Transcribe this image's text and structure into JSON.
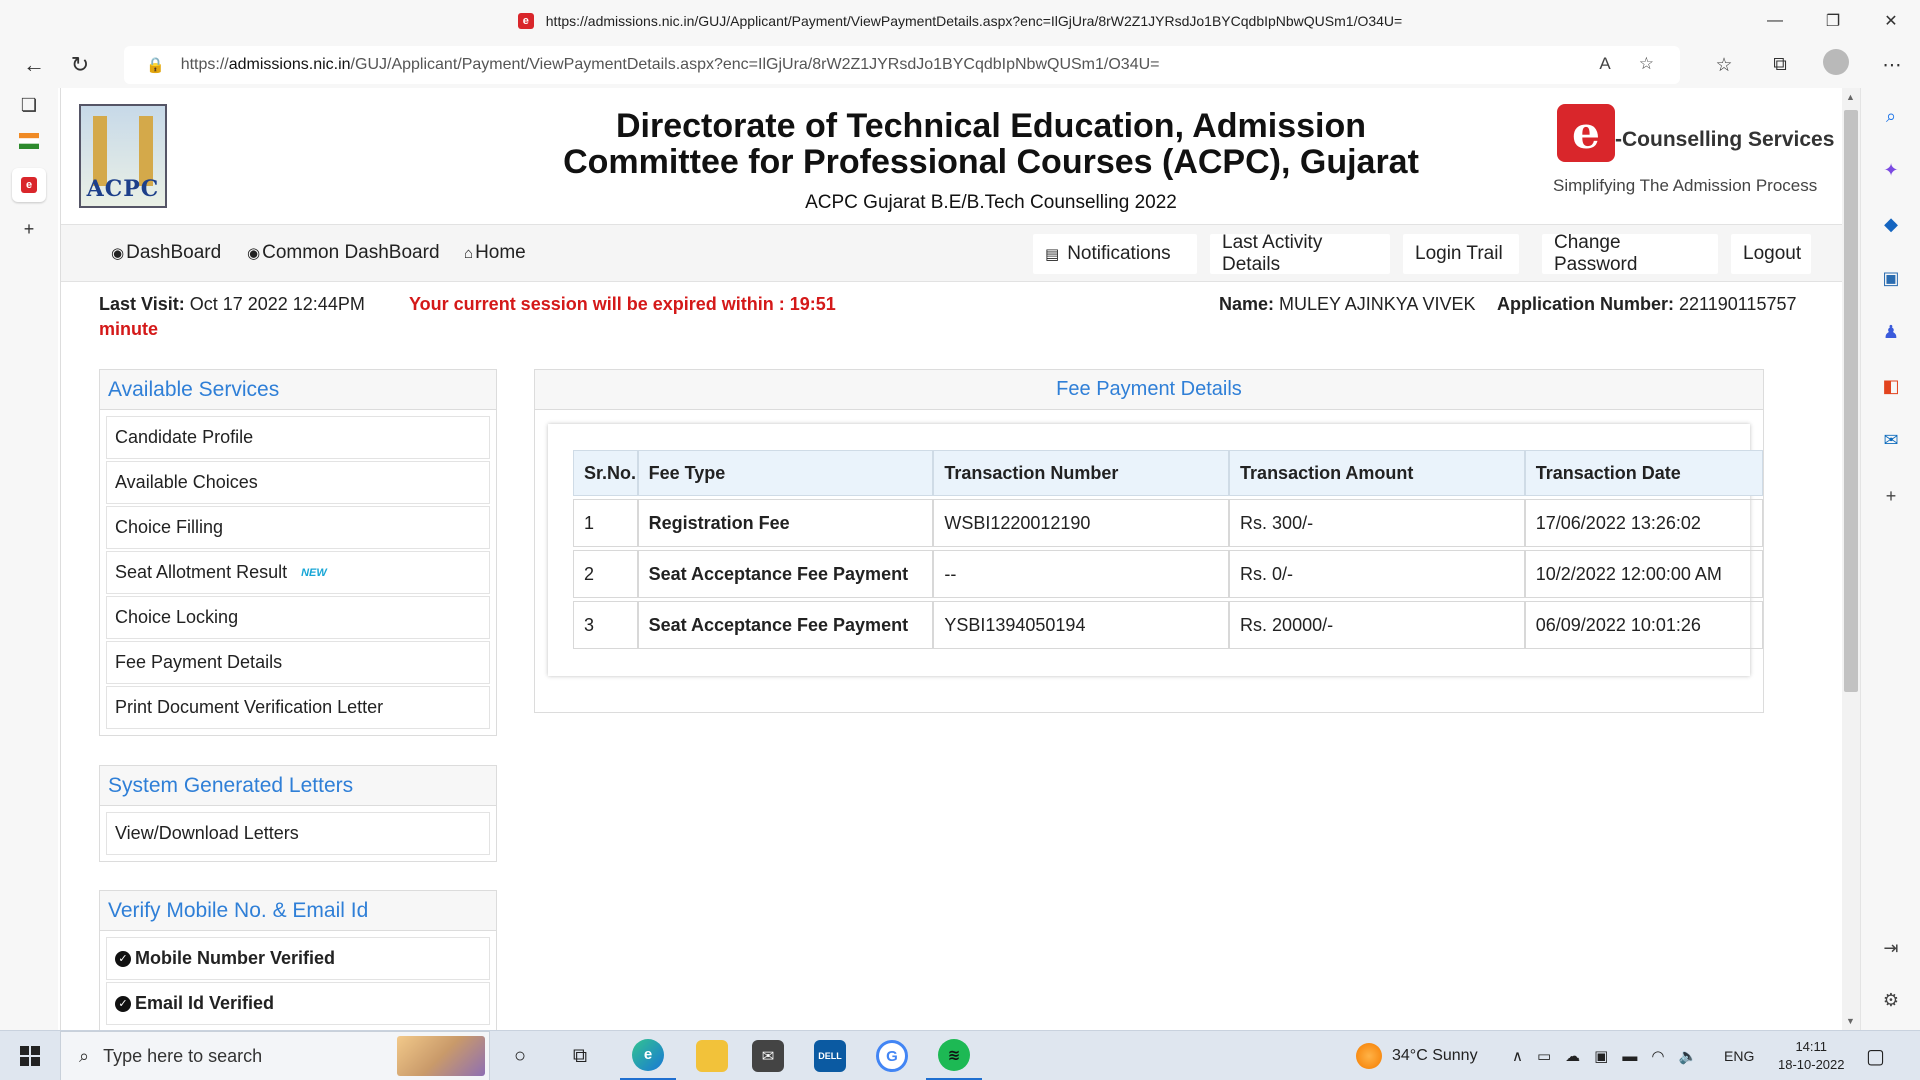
{
  "browser": {
    "title_url": "https://admissions.nic.in/GUJ/Applicant/Payment/ViewPaymentDetails.aspx?enc=IlGjUra/8rW2Z1JYRsdJo1BYCqdbIpNbwQUSm1/O34U=",
    "url_prefix": "https://",
    "url_host": "admissions.nic.in",
    "url_path": "/GUJ/Applicant/Payment/ViewPaymentDetails.aspx?enc=IlGjUra/8rW2Z1JYRsdJo1BYCqdbIpNbwQUSm1/O34U="
  },
  "header": {
    "logo_text": "ACPC",
    "title_line1": "Directorate of Technical Education, Admission",
    "title_line2": "Committee for Professional Courses (ACPC), Gujarat",
    "subtitle": "ACPC Gujarat B.E/B.Tech Counselling 2022",
    "ecounsel_mark": "e",
    "ecounsel_name": "-Counselling Services",
    "ecounsel_tag": "Simplifying The Admission Process"
  },
  "nav": {
    "dashboard": "DashBoard",
    "common_dashboard": "Common DashBoard",
    "home": "Home",
    "notifications": "Notifications",
    "last_activity": "Last Activity Details",
    "login_trail": "Login Trail",
    "change_password": "Change Password",
    "logout": "Logout"
  },
  "info": {
    "last_visit_label": "Last Visit:",
    "last_visit_value": "Oct 17 2022 12:44PM",
    "session_msg": "Your current session will be expired within : 19:51",
    "session_unit": "minute",
    "name_label": "Name:",
    "name_value": "MULEY AJINKYA VIVEK",
    "appno_label": "Application Number:",
    "appno_value": "221190115757"
  },
  "sidebar": {
    "services_title": "Available Services",
    "services": [
      "Candidate Profile",
      "Available Choices",
      "Choice Filling",
      "Seat Allotment Result",
      "Choice Locking",
      "Fee Payment Details",
      "Print Document Verification Letter"
    ],
    "new_badge": "NEW",
    "letters_title": "System Generated Letters",
    "letters": [
      "View/Download Letters"
    ],
    "verify_title": "Verify Mobile No. & Email Id",
    "verify": [
      "Mobile Number Verified",
      "Email Id Verified"
    ]
  },
  "fee": {
    "title": "Fee Payment Details",
    "columns": [
      "Sr.No.",
      "Fee Type",
      "Transaction Number",
      "Transaction Amount",
      "Transaction Date"
    ],
    "rows": [
      [
        "1",
        "Registration Fee",
        "WSBI1220012190",
        "Rs. 300/-",
        "17/06/2022 13:26:02"
      ],
      [
        "2",
        "Seat Acceptance Fee Payment",
        "--",
        "Rs. 0/-",
        "10/2/2022 12:00:00 AM"
      ],
      [
        "3",
        "Seat Acceptance Fee Payment",
        "YSBI1394050194",
        "Rs. 20000/-",
        "06/09/2022 10:01:26"
      ]
    ]
  },
  "taskbar": {
    "search_placeholder": "Type here to search",
    "weather": "34°C  Sunny",
    "lang": "ENG",
    "time": "14:11",
    "date": "18-10-2022"
  },
  "colors": {
    "accent_blue": "#2f7fd7",
    "session_red": "#d41919",
    "brand_red": "#d9262b"
  }
}
